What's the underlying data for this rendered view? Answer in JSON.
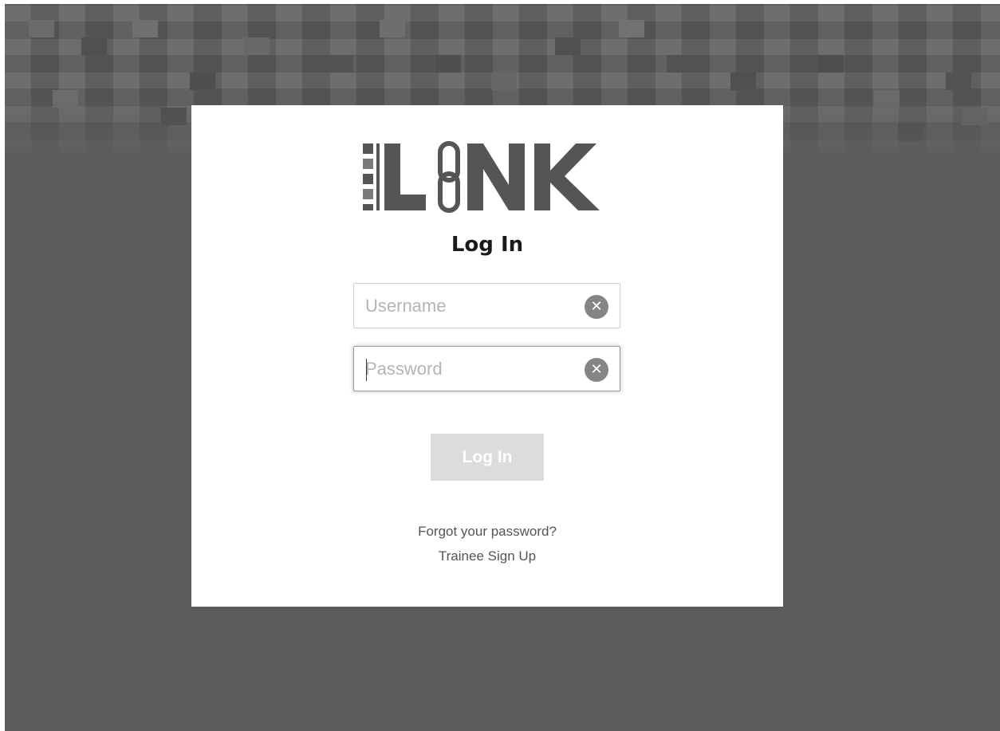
{
  "logo": {
    "text": "LINK",
    "color": "#555555"
  },
  "login_title": "Log In",
  "username_field": {
    "placeholder": "Username",
    "value": "",
    "clear_icon": "clear-circle-x"
  },
  "password_field": {
    "placeholder": "Password",
    "value": "",
    "clear_icon": "clear-circle-x"
  },
  "login_button_label": "Log In",
  "forgot_password_link": "Forgot your password?",
  "trainee_signup_link": "Trainee Sign Up",
  "colors": {
    "background": "#5c5c5c",
    "card": "#ffffff",
    "button_disabled": "#dcdcdc",
    "clear_icon": "#858585"
  }
}
